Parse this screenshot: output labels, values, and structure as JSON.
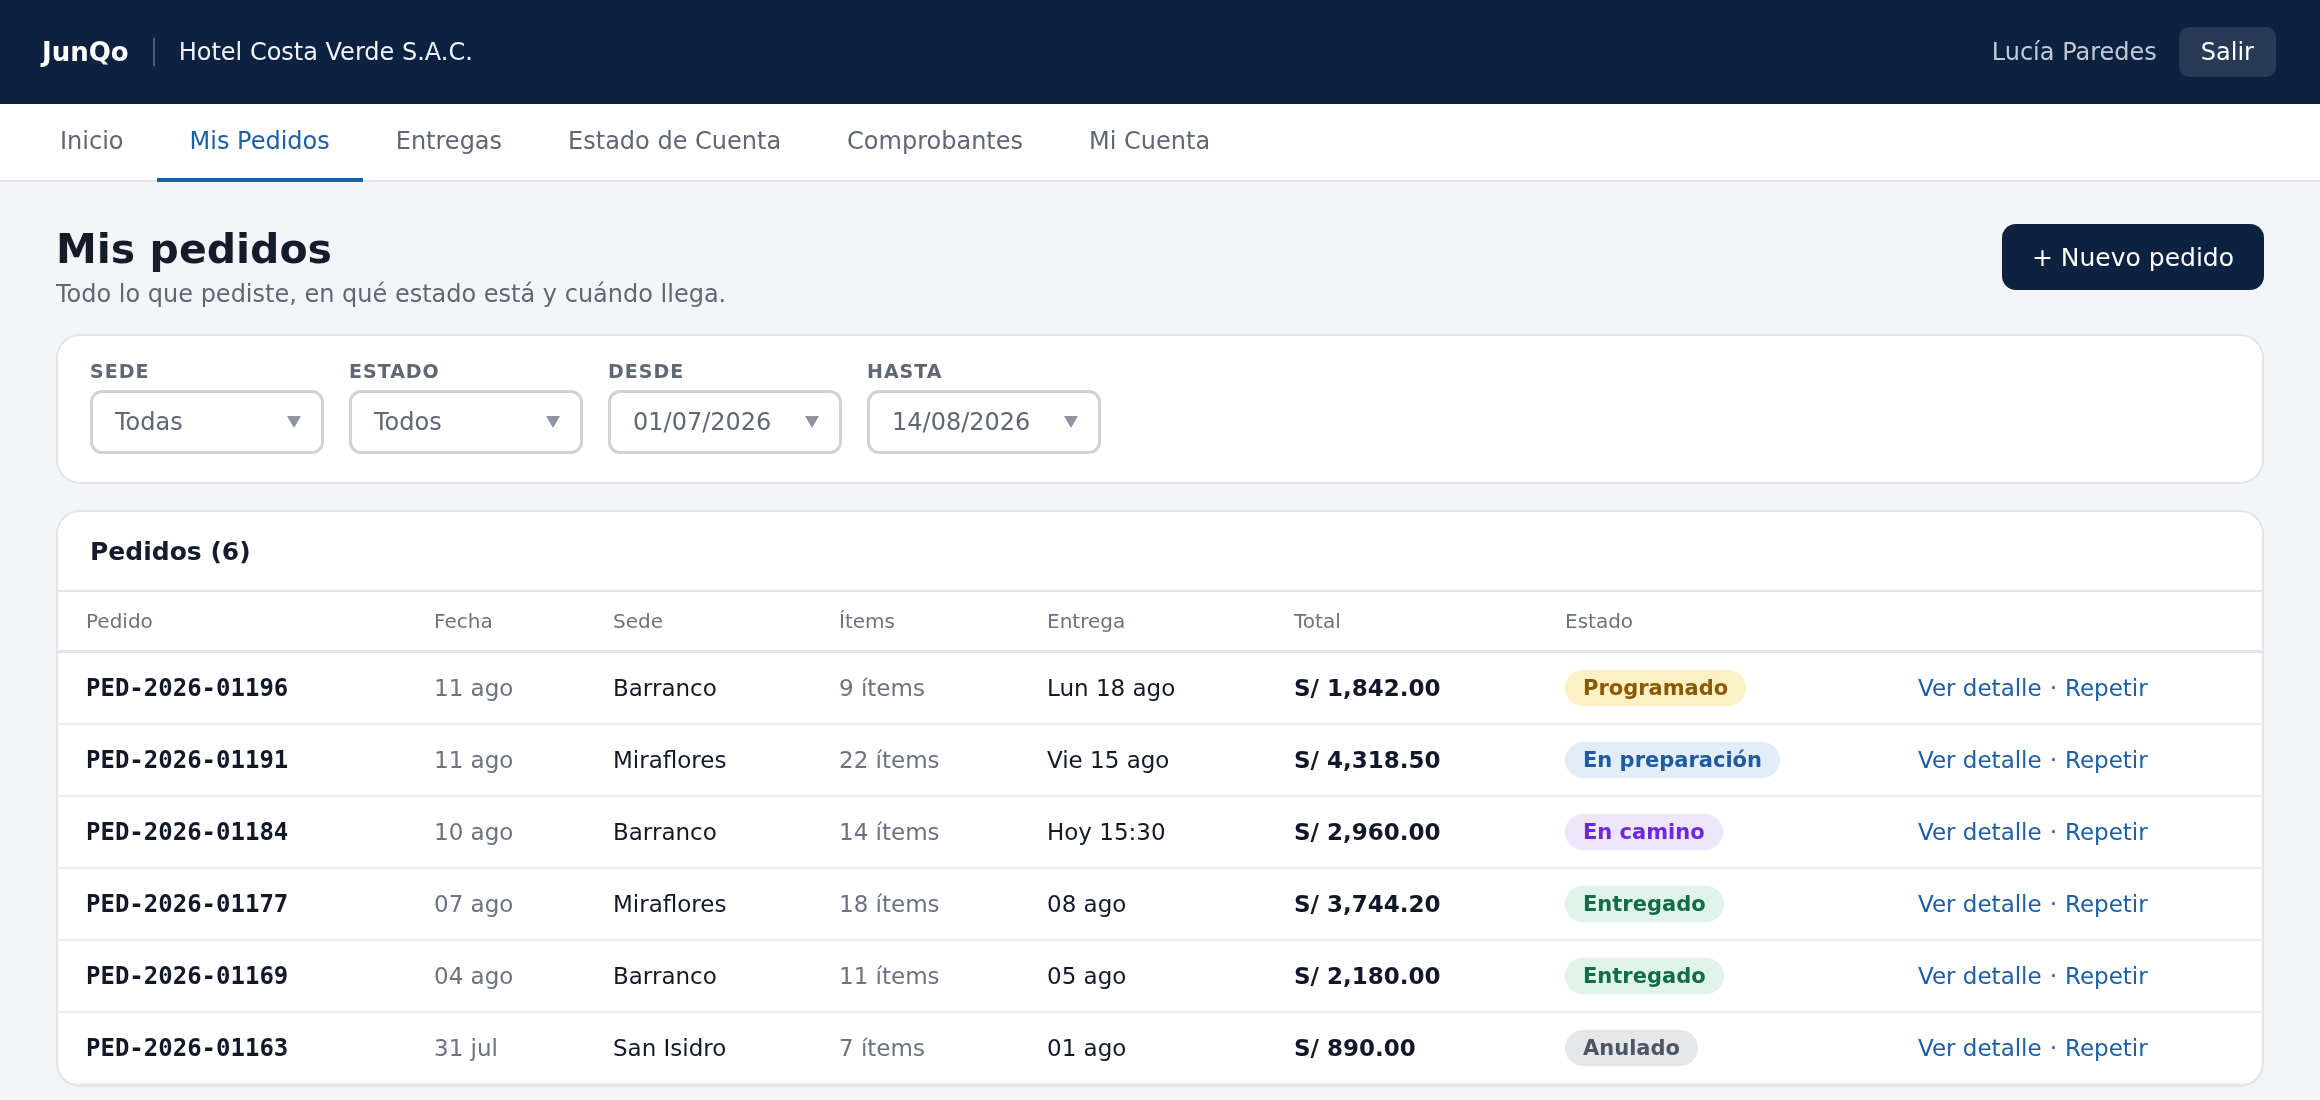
{
  "header": {
    "brand": "JunQo",
    "company": "Hotel Costa Verde S.A.C.",
    "user": "Lucía Paredes",
    "logout": "Salir"
  },
  "tabs": [
    {
      "label": "Inicio",
      "selected": false
    },
    {
      "label": "Mis Pedidos",
      "selected": true
    },
    {
      "label": "Entregas",
      "selected": false
    },
    {
      "label": "Estado de Cuenta",
      "selected": false
    },
    {
      "label": "Comprobantes",
      "selected": false
    },
    {
      "label": "Mi Cuenta",
      "selected": false
    }
  ],
  "page": {
    "title": "Mis pedidos",
    "subtitle": "Todo lo que pediste, en qué estado está y cuándo llega.",
    "new_button": "+ Nuevo pedido"
  },
  "filters": [
    {
      "label": "SEDE",
      "value": "Todas"
    },
    {
      "label": "ESTADO",
      "value": "Todos"
    },
    {
      "label": "DESDE",
      "value": "01/07/2026"
    },
    {
      "label": "HASTA",
      "value": "14/08/2026"
    }
  ],
  "table": {
    "title": "Pedidos (6)",
    "columns": [
      "Pedido",
      "Fecha",
      "Sede",
      "Ítems",
      "Entrega",
      "Total",
      "Estado"
    ],
    "action_separator": "·",
    "rows": [
      {
        "id": "PED-2026-01196",
        "date": "11 ago",
        "site": "Barranco",
        "items": "9 ítems",
        "delivery": "Lun 18 ago",
        "total": "S/ 1,842.00",
        "status": {
          "label": "Programado",
          "kind": "scheduled"
        },
        "actions": [
          "Ver detalle",
          "Repetir"
        ]
      },
      {
        "id": "PED-2026-01191",
        "date": "11 ago",
        "site": "Miraflores",
        "items": "22 ítems",
        "delivery": "Vie 15 ago",
        "total": "S/ 4,318.50",
        "status": {
          "label": "En preparación",
          "kind": "preparing"
        },
        "actions": [
          "Ver detalle",
          "Repetir"
        ]
      },
      {
        "id": "PED-2026-01184",
        "date": "10 ago",
        "site": "Barranco",
        "items": "14 ítems",
        "delivery": "Hoy 15:30",
        "total": "S/ 2,960.00",
        "status": {
          "label": "En camino",
          "kind": "transit"
        },
        "actions": [
          "Ver detalle",
          "Repetir"
        ]
      },
      {
        "id": "PED-2026-01177",
        "date": "07 ago",
        "site": "Miraflores",
        "items": "18 ítems",
        "delivery": "08 ago",
        "total": "S/ 3,744.20",
        "status": {
          "label": "Entregado",
          "kind": "delivered"
        },
        "actions": [
          "Ver detalle",
          "Repetir"
        ]
      },
      {
        "id": "PED-2026-01169",
        "date": "04 ago",
        "site": "Barranco",
        "items": "11 ítems",
        "delivery": "05 ago",
        "total": "S/ 2,180.00",
        "status": {
          "label": "Entregado",
          "kind": "delivered"
        },
        "actions": [
          "Ver detalle",
          "Repetir"
        ]
      },
      {
        "id": "PED-2026-01163",
        "date": "31 jul",
        "site": "San Isidro",
        "items": "7 ítems",
        "delivery": "01 ago",
        "total": "S/ 890.00",
        "status": {
          "label": "Anulado",
          "kind": "cancelled"
        },
        "actions": [
          "Ver detalle",
          "Repetir"
        ]
      }
    ]
  }
}
